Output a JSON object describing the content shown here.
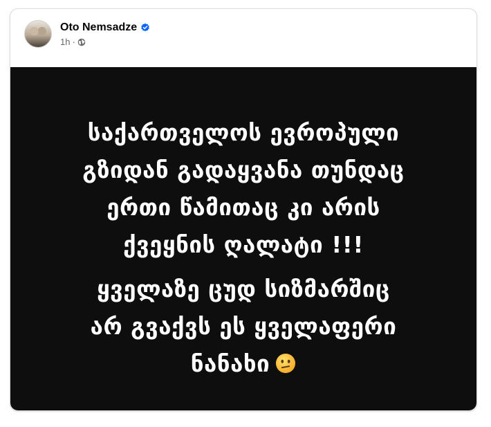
{
  "post": {
    "author": "Oto Nemsadze",
    "time": "1h",
    "separator": "·",
    "content_lines_1": [
      "საქართველოს ევროპული",
      "გზიდან გადაყვანა თუნდაც",
      "ერთი წამითაც კი არის",
      "ქვეყნის ღალატი !!!"
    ],
    "content_lines_2": [
      "ყველაზე ცუდ სიზმარშიც",
      "არ გვაქვს ეს ყველაფერი",
      "ნანახი"
    ],
    "emoji": "confused-face-emoji",
    "verified_icon": "verified-badge-icon",
    "privacy_icon": "globe-icon",
    "colors": {
      "background": "#0e0e0e",
      "text": "#ffffff",
      "verified": "#0866ff",
      "meta": "#65676b"
    }
  }
}
